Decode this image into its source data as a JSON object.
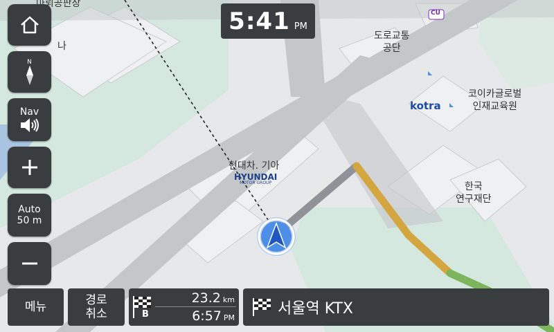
{
  "clock": {
    "time": "5:41",
    "ampm": "PM"
  },
  "buttons": {
    "compass_letter": "N",
    "nav_label": "Nav",
    "zoom_mode": "Auto",
    "zoom_scale": "50 m"
  },
  "bottom_bar": {
    "menu_label": "메뉴",
    "cancel_route_line1": "경로",
    "cancel_route_line2": "취소",
    "distance_value": "23.2",
    "distance_unit": "km",
    "eta_time": "6:57",
    "eta_ampm": "PM",
    "waypoint_letter": "B",
    "destination": "서울역 KTX"
  },
  "map": {
    "labels": {
      "top_left_partial": "마뢰공판장",
      "na": "나",
      "road_corp_line1": "도로교통",
      "road_corp_line2": "공단",
      "kotra_logo": "kotra",
      "koica_line1": "코이카글로벌",
      "koica_line2": "인재교육원",
      "hyundai_name": "현대차. 기아",
      "hyundai_logo": "HYUNDAI",
      "hyundai_sub": "MOTOR GROUP",
      "krf_line1": "한국",
      "krf_line2": "연구재단",
      "cu_store": "CU"
    },
    "colors": {
      "background": "#e6e8ea",
      "park": "#d4e8df",
      "water": "#a9c4e0",
      "road": "#c4c7ca",
      "route_gray": "#8f9296",
      "route_orange": "#d4a640",
      "route_green": "#7cb55c",
      "vehicle": "#3a78d8"
    }
  }
}
